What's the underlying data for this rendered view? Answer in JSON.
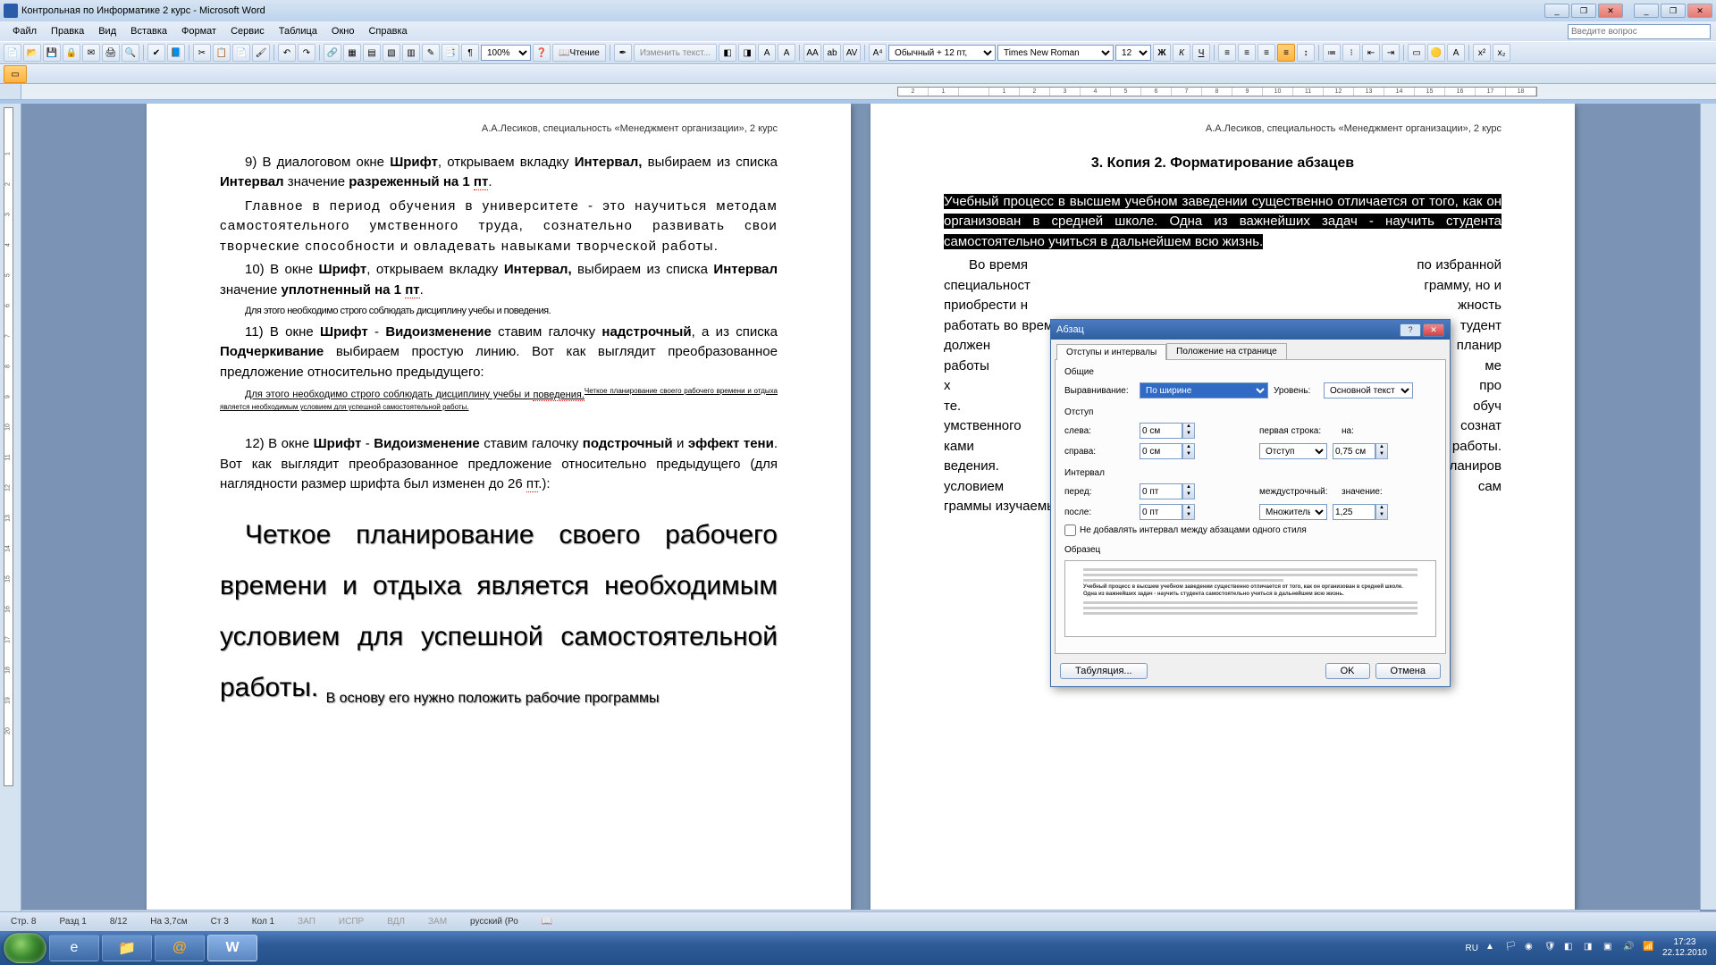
{
  "title": "Контрольная по Информатике  2 курс - Microsoft Word",
  "menu": [
    "Файл",
    "Правка",
    "Вид",
    "Вставка",
    "Формат",
    "Сервис",
    "Таблица",
    "Окно",
    "Справка"
  ],
  "search_placeholder": "Введите вопрос",
  "zoom": "100%",
  "reading": "Чтение",
  "change_text": "Изменить текст...",
  "style": "Обычный + 12 пт,",
  "font": "Times New Roman",
  "fontsize": "12",
  "ruler_labels": [
    "2",
    "1",
    "",
    "1",
    "2",
    "3",
    "4",
    "5",
    "6",
    "7",
    "8",
    "9",
    "10",
    "11",
    "12",
    "13",
    "14",
    "15",
    "16",
    "17",
    "18"
  ],
  "vruler": [
    "",
    "1",
    "2",
    "3",
    "4",
    "5",
    "6",
    "7",
    "8",
    "9",
    "10",
    "11",
    "12",
    "13",
    "14",
    "15",
    "16",
    "17",
    "18",
    "19",
    "20"
  ],
  "page_left": {
    "hdr": "А.А.Лесиков, специальность «Менеджмент организации», 2 курс",
    "p1a": "9) В диалоговом окне ",
    "p1b": "Шрифт",
    "p1c": ", открываем вкладку ",
    "p1d": "Интервал,",
    "p1e": " выбираем из списка ",
    "p1f": "Интервал",
    "p1g": " значение ",
    "p1h": "разреженный на 1 ",
    "p1i": "пт",
    "p1j": ".",
    "p2": "Главное в период обучения в университете - это научиться методам самостоятельного умственного труда, сознательно развивать свои творческие способности и овладевать навыками творческой работы.",
    "p3a": "10) В  окне ",
    "p3b": "Шрифт",
    "p3c": ", открываем вкладку ",
    "p3d": "Интервал,",
    "p3e": " выбираем из списка ",
    "p3f": "Интервал",
    "p3g": " значение ",
    "p3h": "уплотненный на 1 ",
    "p3i": "пт",
    "p3j": ".",
    "p4": "Для этого необходимо строго соблюдать дисциплину учебы и поведения.",
    "p5a": "11) В окне  ",
    "p5b": "Шрифт",
    "p5c": " - ",
    "p5d": "Видоизменение",
    "p5e": " ставим галочку ",
    "p5f": "надстрочный",
    "p5g": ", а из списка ",
    "p5h": "Подчеркивание",
    "p5i": " выбираем простую линию. Вот как выглядит преобразованное предложение относительно предыдущего:",
    "p6a": "Для этого необходимо строго соблюдать дисциплину учебы и ",
    "p6b": "поведения.",
    "p6c": "Четкое планирование своего рабочего времени и отдыха является необходимым условием для успешной самостоятельной работы.",
    "p7a": "12)  В окне  ",
    "p7b": "Шрифт",
    "p7c": " - ",
    "p7d": "Видоизменение",
    "p7e": " ставим галочку ",
    "p7f": "подстрочный",
    "p7g": " и ",
    "p7h": "эффект тени",
    "p7i": ". Вот как выглядит преобразованное предложение относительно предыдущего (для наглядности размер шрифта был изменен до 26 ",
    "p7j": "пт",
    "p7k": ".):",
    "big1": "Четкое планирование своего рабочего времени и отдыха является необходимым условием для успешной самостоятельной работы.",
    "big2": "В основу его нужно положить рабочие программы"
  },
  "page_right": {
    "hdr": "А.А.Лесиков, специальность «Менеджмент организации», 2 курс",
    "h3": "3. Копия 2. Форматирование абзацев",
    "sel": "Учебный процесс в высшем учебном заведении существенно отличается от того, как он организован в средней школе. Одна из важнейших задач - научить студента самостоятельно учиться в дальнейшем всю жизнь.",
    "body": "Во время                                                                                                по избранной специальност                                                                                                        грамму, но и приобрести н                                                                                                         жность работать во время                                                                                                          тудент должен уметь планир                                                                                                        работы повышается по ме                                                                                                           х и графиках учебного про                                                                                                         те. Главное в период обуч                                                                                                          умственного труда, сознат                                                                                                          ками творческой работы.                                                                                                            ведения. Четкое планиров                                                                                                           условием для успешной сам                                                                                                          граммы изучаемых в семе"
  },
  "dialog": {
    "title": "Абзац",
    "tab1": "Отступы и интервалы",
    "tab2": "Положение на странице",
    "grp_general": "Общие",
    "lbl_align": "Выравнивание:",
    "val_align": "По ширине",
    "lbl_level": "Уровень:",
    "val_level": "Основной текст",
    "grp_indent": "Отступ",
    "lbl_left": "слева:",
    "val_left": "0 см",
    "lbl_right": "справа:",
    "val_right": "0 см",
    "lbl_firstline": "первая строка:",
    "val_firstline": "Отступ",
    "lbl_by": "на:",
    "val_by": "0,75 см",
    "grp_spacing": "Интервал",
    "lbl_before": "перед:",
    "val_before": "0 пт",
    "lbl_after": "после:",
    "val_after": "0 пт",
    "lbl_linesp": "междустрочный:",
    "val_linesp": "Множитель",
    "lbl_value": "значение:",
    "val_value": "1,25",
    "chk": "Не добавлять интервал между абзацами одного стиля",
    "grp_preview": "Образец",
    "preview_text": "Учебный процесс в высшем учебном заведении существенно отличается от того, как он организован в средней школе. Одна из важнейших задач - научить студента самостоятельно учиться в дальнейшем всю жизнь.",
    "btn_tabs": "Табуляция...",
    "btn_ok": "OK",
    "btn_cancel": "Отмена"
  },
  "status": {
    "page": "Стр. 8",
    "sec": "Разд 1",
    "pages": "8/12",
    "at": "На  3,7см",
    "ln": "Ст  3",
    "col": "Кол  1",
    "rec": "ЗАП",
    "trk": "ИСПР",
    "ext": "ВДЛ",
    "ovr": "ЗАМ",
    "lang": "русский (Ро"
  },
  "tray": {
    "lang": "RU",
    "time": "17:23",
    "date": "22.12.2010"
  }
}
